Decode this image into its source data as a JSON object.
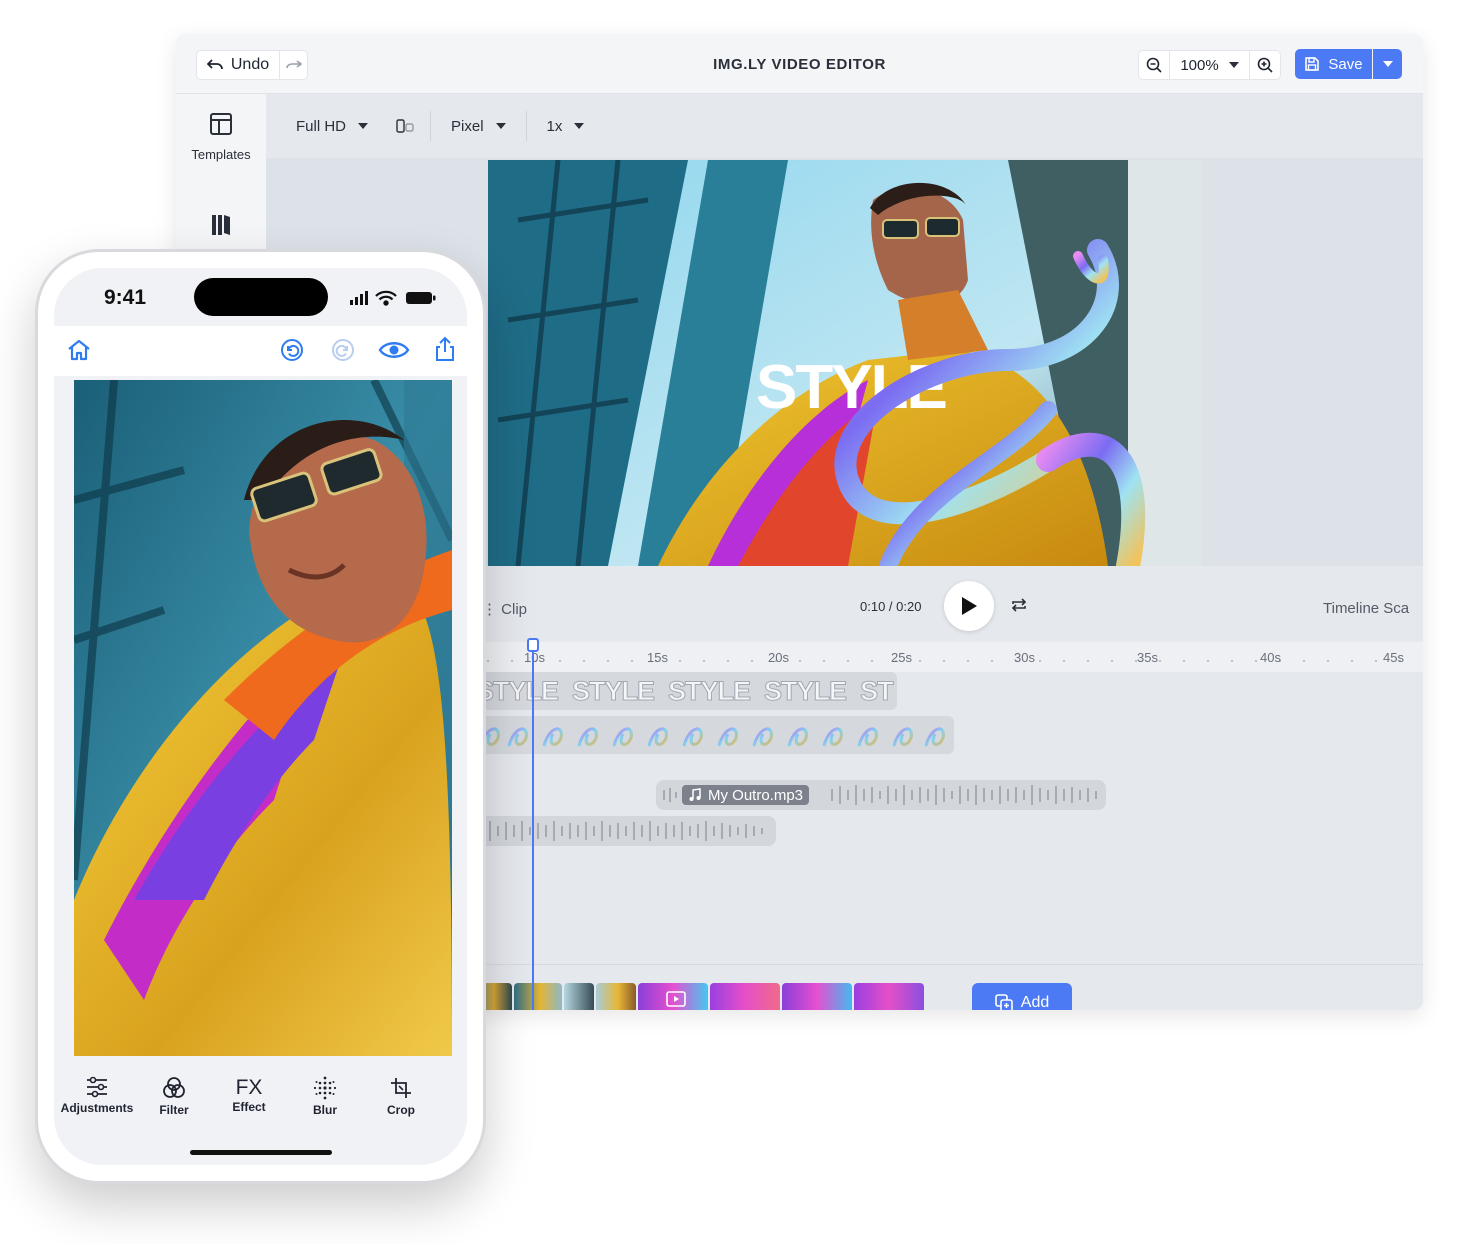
{
  "editor": {
    "title": "IMG.LY VIDEO EDITOR",
    "undo_label": "Undo",
    "zoom_value": "100%",
    "save_label": "Save",
    "rail": [
      {
        "label": "Templates"
      }
    ],
    "subbar": {
      "resolution": "Full HD",
      "unit": "Pixel",
      "scale": "1x"
    },
    "preview_text": "STYLE",
    "timeline": {
      "left_label": "Clip",
      "time": "0:10  /  0:20",
      "right_label": "Timeline Sca",
      "ticks": [
        "10s",
        "15s",
        "20s",
        "25s",
        "30s",
        "35s",
        "40s",
        "45s"
      ],
      "text_track": [
        "STYLE",
        "STYLE",
        "STYLE",
        "STYLE",
        "ST"
      ],
      "audio_label": "My Outro.mp3",
      "add_label": "Add"
    },
    "colors": {
      "accent": "#4c79f4"
    }
  },
  "phone": {
    "status_time": "9:41",
    "tools": [
      {
        "label": "Adjustments",
        "icon": "sliders-icon"
      },
      {
        "label": "Filter",
        "icon": "filter-circles-icon"
      },
      {
        "label": "Effect",
        "icon": "fx-icon",
        "glyph": "FX"
      },
      {
        "label": "Blur",
        "icon": "blur-dots-icon"
      },
      {
        "label": "Crop",
        "icon": "crop-icon"
      }
    ]
  }
}
